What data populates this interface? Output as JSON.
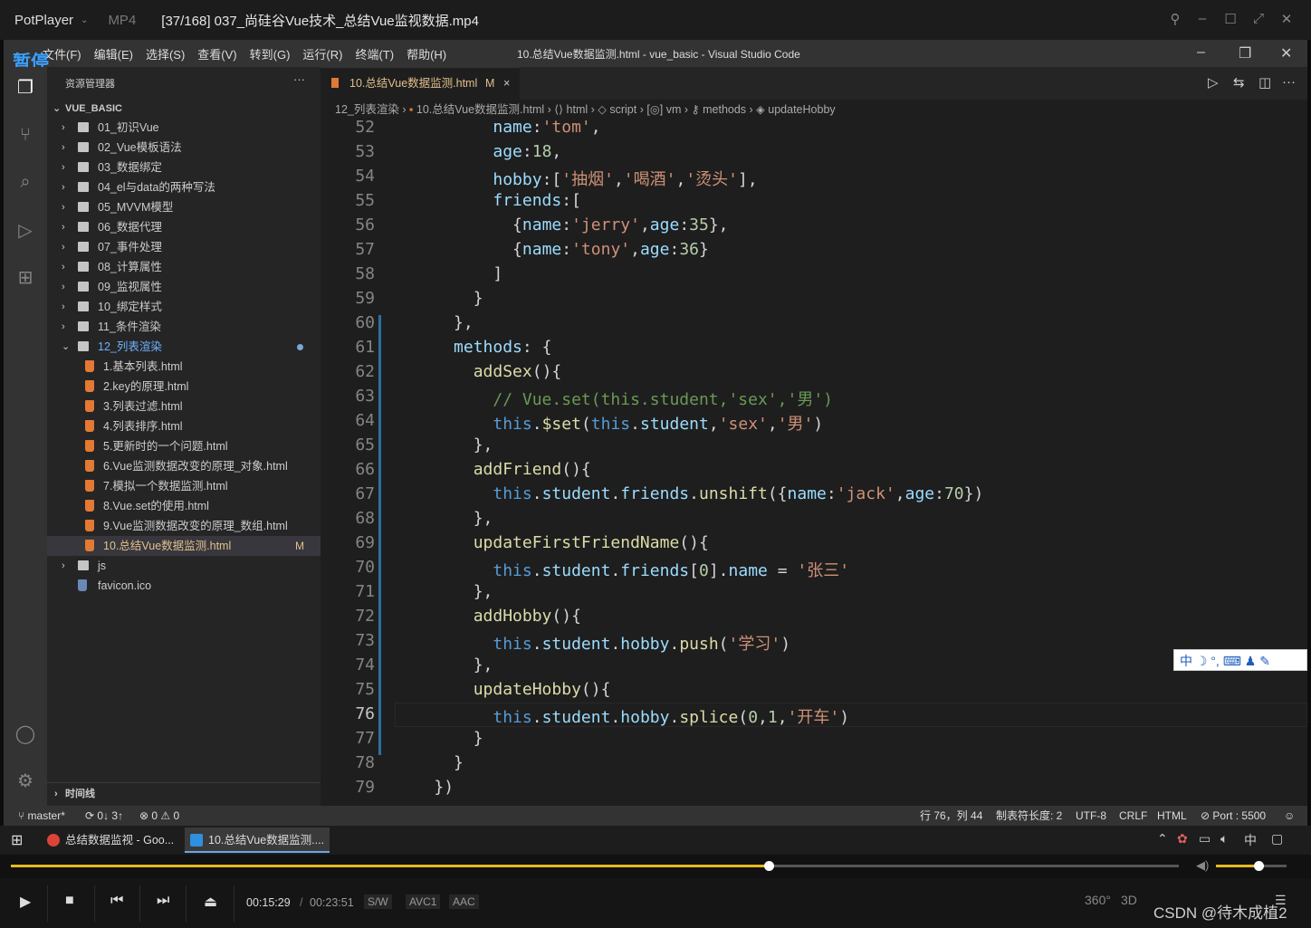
{
  "player": {
    "logo": "PotPlayer",
    "format": "MP4",
    "file_title": "[37/168] 037_尚硅谷Vue技术_总结Vue监视数据.mp4",
    "paused_label": "暂停"
  },
  "vscode": {
    "menu": [
      "文件(F)",
      "编辑(E)",
      "选择(S)",
      "查看(V)",
      "转到(G)",
      "运行(R)",
      "终端(T)",
      "帮助(H)"
    ],
    "window_title": "10.总结Vue数据监测.html - vue_basic - Visual Studio Code",
    "sidebar": {
      "title": "资源管理器",
      "root": "VUE_BASIC",
      "items": [
        {
          "label": "01_初识Vue",
          "kind": "folder"
        },
        {
          "label": "02_Vue模板语法",
          "kind": "folder"
        },
        {
          "label": "03_数据绑定",
          "kind": "folder"
        },
        {
          "label": "04_el与data的两种写法",
          "kind": "folder"
        },
        {
          "label": "05_MVVM模型",
          "kind": "folder"
        },
        {
          "label": "06_数据代理",
          "kind": "folder"
        },
        {
          "label": "07_事件处理",
          "kind": "folder"
        },
        {
          "label": "08_计算属性",
          "kind": "folder"
        },
        {
          "label": "09_监视属性",
          "kind": "folder"
        },
        {
          "label": "10_绑定样式",
          "kind": "folder"
        },
        {
          "label": "11_条件渲染",
          "kind": "folder"
        },
        {
          "label": "12_列表渲染",
          "kind": "folder-open"
        },
        {
          "label": "1.基本列表.html",
          "kind": "html"
        },
        {
          "label": "2.key的原理.html",
          "kind": "html"
        },
        {
          "label": "3.列表过滤.html",
          "kind": "html"
        },
        {
          "label": "4.列表排序.html",
          "kind": "html"
        },
        {
          "label": "5.更新时的一个问题.html",
          "kind": "html"
        },
        {
          "label": "6.Vue监测数据改变的原理_对象.html",
          "kind": "html"
        },
        {
          "label": "7.模拟一个数据监测.html",
          "kind": "html"
        },
        {
          "label": "8.Vue.set的使用.html",
          "kind": "html"
        },
        {
          "label": "9.Vue监测数据改变的原理_数组.html",
          "kind": "html"
        },
        {
          "label": "10.总结Vue数据监测.html",
          "kind": "html",
          "badge": "M"
        },
        {
          "label": "js",
          "kind": "folder"
        },
        {
          "label": "favicon.ico",
          "kind": "file"
        }
      ],
      "timeline": "时间线"
    },
    "tab": {
      "label": "10.总结Vue数据监测.html",
      "modified": "M",
      "close": "×"
    },
    "breadcrumbs": [
      "12_列表渲染",
      "10.总结Vue数据监测.html",
      "html",
      "script",
      "vm",
      "methods",
      "updateHobby"
    ],
    "code": [
      {
        "n": "52",
        "t": [
          [
            "",
            "          "
          ],
          [
            "k",
            "name"
          ],
          [
            "p",
            ":"
          ],
          [
            "s",
            "'tom'"
          ],
          [
            "p",
            ","
          ]
        ]
      },
      {
        "n": "53",
        "t": [
          [
            "",
            "          "
          ],
          [
            "k",
            "age"
          ],
          [
            "p",
            ":"
          ],
          [
            "n",
            "18"
          ],
          [
            "p",
            ","
          ]
        ]
      },
      {
        "n": "54",
        "t": [
          [
            "",
            "          "
          ],
          [
            "k",
            "hobby"
          ],
          [
            "p",
            ":["
          ],
          [
            "s",
            "'抽烟'"
          ],
          [
            "p",
            ","
          ],
          [
            "s",
            "'喝酒'"
          ],
          [
            "p",
            ","
          ],
          [
            "s",
            "'烫头'"
          ],
          [
            "p",
            "],"
          ]
        ]
      },
      {
        "n": "55",
        "t": [
          [
            "",
            "          "
          ],
          [
            "k",
            "friends"
          ],
          [
            "p",
            ":["
          ]
        ]
      },
      {
        "n": "56",
        "t": [
          [
            "",
            "            "
          ],
          [
            "p",
            "{"
          ],
          [
            "k",
            "name"
          ],
          [
            "p",
            ":"
          ],
          [
            "s",
            "'jerry'"
          ],
          [
            "p",
            ","
          ],
          [
            "k",
            "age"
          ],
          [
            "p",
            ":"
          ],
          [
            "n",
            "35"
          ],
          [
            "p",
            "},"
          ]
        ]
      },
      {
        "n": "57",
        "t": [
          [
            "",
            "            "
          ],
          [
            "p",
            "{"
          ],
          [
            "k",
            "name"
          ],
          [
            "p",
            ":"
          ],
          [
            "s",
            "'tony'"
          ],
          [
            "p",
            ","
          ],
          [
            "k",
            "age"
          ],
          [
            "p",
            ":"
          ],
          [
            "n",
            "36"
          ],
          [
            "p",
            "}"
          ]
        ]
      },
      {
        "n": "58",
        "t": [
          [
            "",
            "          "
          ],
          [
            "p",
            "]"
          ]
        ]
      },
      {
        "n": "59",
        "t": [
          [
            "",
            "        "
          ],
          [
            "p",
            "}"
          ]
        ]
      },
      {
        "n": "60",
        "t": [
          [
            "",
            "      "
          ],
          [
            "p",
            "},"
          ]
        ]
      },
      {
        "n": "61",
        "t": [
          [
            "",
            "      "
          ],
          [
            "k",
            "methods"
          ],
          [
            "p",
            ": {"
          ]
        ]
      },
      {
        "n": "62",
        "t": [
          [
            "",
            "        "
          ],
          [
            "f",
            "addSex"
          ],
          [
            "p",
            "(){"
          ]
        ]
      },
      {
        "n": "63",
        "t": [
          [
            "",
            "          "
          ],
          [
            "c",
            "// Vue.set(this.student,'sex','男')"
          ]
        ]
      },
      {
        "n": "64",
        "t": [
          [
            "",
            "          "
          ],
          [
            "t",
            "this"
          ],
          [
            "p",
            "."
          ],
          [
            "f",
            "$set"
          ],
          [
            "p",
            "("
          ],
          [
            "t",
            "this"
          ],
          [
            "p",
            "."
          ],
          [
            "k",
            "student"
          ],
          [
            "p",
            ","
          ],
          [
            "s",
            "'sex'"
          ],
          [
            "p",
            ","
          ],
          [
            "s",
            "'男'"
          ],
          [
            "p",
            ")"
          ]
        ]
      },
      {
        "n": "65",
        "t": [
          [
            "",
            "        "
          ],
          [
            "p",
            "},"
          ]
        ]
      },
      {
        "n": "66",
        "t": [
          [
            "",
            "        "
          ],
          [
            "f",
            "addFriend"
          ],
          [
            "p",
            "(){"
          ]
        ]
      },
      {
        "n": "67",
        "t": [
          [
            "",
            "          "
          ],
          [
            "t",
            "this"
          ],
          [
            "p",
            "."
          ],
          [
            "k",
            "student"
          ],
          [
            "p",
            "."
          ],
          [
            "k",
            "friends"
          ],
          [
            "p",
            "."
          ],
          [
            "f",
            "unshift"
          ],
          [
            "p",
            "({"
          ],
          [
            "k",
            "name"
          ],
          [
            "p",
            ":"
          ],
          [
            "s",
            "'jack'"
          ],
          [
            "p",
            ","
          ],
          [
            "k",
            "age"
          ],
          [
            "p",
            ":"
          ],
          [
            "n",
            "70"
          ],
          [
            "p",
            "})"
          ]
        ]
      },
      {
        "n": "68",
        "t": [
          [
            "",
            "        "
          ],
          [
            "p",
            "},"
          ]
        ]
      },
      {
        "n": "69",
        "t": [
          [
            "",
            "        "
          ],
          [
            "f",
            "updateFirstFriendName"
          ],
          [
            "p",
            "(){"
          ]
        ]
      },
      {
        "n": "70",
        "t": [
          [
            "",
            "          "
          ],
          [
            "t",
            "this"
          ],
          [
            "p",
            "."
          ],
          [
            "k",
            "student"
          ],
          [
            "p",
            "."
          ],
          [
            "k",
            "friends"
          ],
          [
            "p",
            "["
          ],
          [
            "n",
            "0"
          ],
          [
            "p",
            "]."
          ],
          [
            "k",
            "name"
          ],
          [
            "p",
            " = "
          ],
          [
            "s",
            "'张三'"
          ]
        ]
      },
      {
        "n": "71",
        "t": [
          [
            "",
            "        "
          ],
          [
            "p",
            "},"
          ]
        ]
      },
      {
        "n": "72",
        "t": [
          [
            "",
            "        "
          ],
          [
            "f",
            "addHobby"
          ],
          [
            "p",
            "(){"
          ]
        ]
      },
      {
        "n": "73",
        "t": [
          [
            "",
            "          "
          ],
          [
            "t",
            "this"
          ],
          [
            "p",
            "."
          ],
          [
            "k",
            "student"
          ],
          [
            "p",
            "."
          ],
          [
            "k",
            "hobby"
          ],
          [
            "p",
            "."
          ],
          [
            "f",
            "push"
          ],
          [
            "p",
            "("
          ],
          [
            "s",
            "'学习'"
          ],
          [
            "p",
            ")"
          ]
        ]
      },
      {
        "n": "74",
        "t": [
          [
            "",
            "        "
          ],
          [
            "p",
            "},"
          ]
        ]
      },
      {
        "n": "75",
        "t": [
          [
            "",
            "        "
          ],
          [
            "f",
            "updateHobby"
          ],
          [
            "p",
            "(){"
          ]
        ]
      },
      {
        "n": "76",
        "t": [
          [
            "",
            "          "
          ],
          [
            "t",
            "this"
          ],
          [
            "p",
            "."
          ],
          [
            "k",
            "student"
          ],
          [
            "p",
            "."
          ],
          [
            "k",
            "hobby"
          ],
          [
            "p",
            "."
          ],
          [
            "f",
            "splice"
          ],
          [
            "p",
            "("
          ],
          [
            "n",
            "0"
          ],
          [
            "p",
            ","
          ],
          [
            "n",
            "1"
          ],
          [
            "p",
            ","
          ],
          [
            "s",
            "'开车'"
          ],
          [
            "p",
            ")"
          ]
        ]
      },
      {
        "n": "77",
        "t": [
          [
            "",
            "        "
          ],
          [
            "p",
            "}"
          ]
        ]
      },
      {
        "n": "78",
        "t": [
          [
            "",
            "      "
          ],
          [
            "p",
            "}"
          ]
        ]
      },
      {
        "n": "79",
        "t": [
          [
            "",
            "    "
          ],
          [
            "p",
            "})"
          ]
        ]
      }
    ],
    "ime_toolbar": "中 ☽ °, ⌨ ♟ ✎",
    "status": {
      "branch": "master*",
      "sync": "0↓ 3↑",
      "problems": "⊗ 0 ⚠ 0",
      "position": "行 76，列 44",
      "tab_size": "制表符长度: 2",
      "encoding": "UTF-8",
      "eol": "CRLF",
      "language": "HTML",
      "port": "⊘ Port : 5500"
    }
  },
  "taskbar": {
    "items": [
      "总结数据监视 - Goo...",
      "10.总结Vue数据监测...."
    ],
    "ime": "中"
  },
  "playback": {
    "progress": 0.649,
    "volume": 0.6,
    "current_time": "00:15:29",
    "separator": "/",
    "total_time": "00:23:51",
    "badges": [
      "S/W",
      "AVC1",
      "AAC"
    ],
    "right_labels": [
      "360°",
      "3D"
    ],
    "watermark": "CSDN @待木成植2"
  },
  "colors": {
    "accent_blue": "#3aa0ff",
    "progress": "#e6b91e",
    "html_icon": "#e37933",
    "modified": "#e2c08d"
  }
}
